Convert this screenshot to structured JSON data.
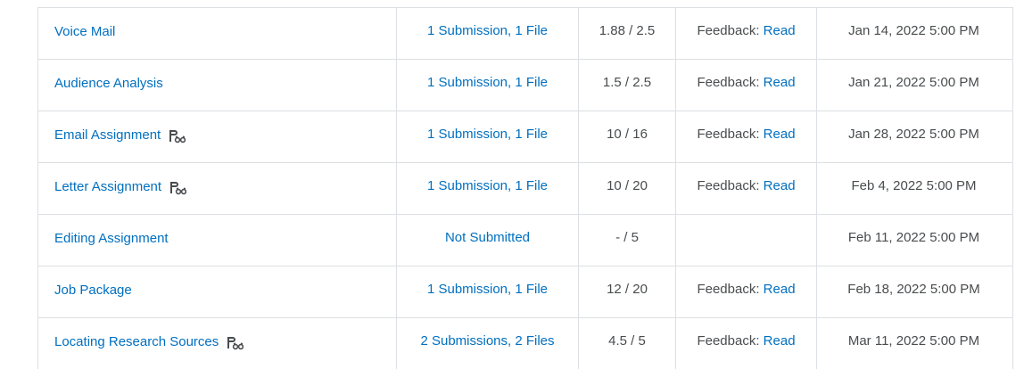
{
  "rows": [
    {
      "name": "Voice Mail",
      "has_icon": false,
      "submission": "1 Submission, 1 File",
      "score": "1.88 / 2.5",
      "feedback_prefix": "Feedback:",
      "feedback_link": "Read",
      "due": "Jan 14, 2022 5:00 PM"
    },
    {
      "name": "Audience Analysis",
      "has_icon": false,
      "submission": "1 Submission, 1 File",
      "score": "1.5 / 2.5",
      "feedback_prefix": "Feedback:",
      "feedback_link": "Read",
      "due": "Jan 21, 2022 5:00 PM"
    },
    {
      "name": "Email Assignment",
      "has_icon": true,
      "submission": "1 Submission, 1 File",
      "score": "10 / 16",
      "feedback_prefix": "Feedback:",
      "feedback_link": "Read",
      "due": "Jan 28, 2022 5:00 PM"
    },
    {
      "name": "Letter Assignment",
      "has_icon": true,
      "submission": "1 Submission, 1 File",
      "score": "10 / 20",
      "feedback_prefix": "Feedback:",
      "feedback_link": "Read",
      "due": "Feb 4, 2022 5:00 PM"
    },
    {
      "name": "Editing Assignment",
      "has_icon": false,
      "submission": "Not Submitted",
      "score": "- / 5",
      "feedback_prefix": "",
      "feedback_link": "",
      "due": "Feb 11, 2022 5:00 PM"
    },
    {
      "name": "Job Package",
      "has_icon": false,
      "submission": "1 Submission, 1 File",
      "score": "12 / 20",
      "feedback_prefix": "Feedback:",
      "feedback_link": "Read",
      "due": "Feb 18, 2022 5:00 PM"
    },
    {
      "name": "Locating Research Sources",
      "has_icon": true,
      "submission": "2 Submissions, 2 Files",
      "score": "4.5 / 5",
      "feedback_prefix": "Feedback:",
      "feedback_link": "Read",
      "due": "Mar 11, 2022 5:00 PM"
    }
  ],
  "icon": "turnitin-originality-icon",
  "colors": {
    "link": "#006fbf",
    "text": "#494c4e",
    "border": "#dcdfe3"
  }
}
